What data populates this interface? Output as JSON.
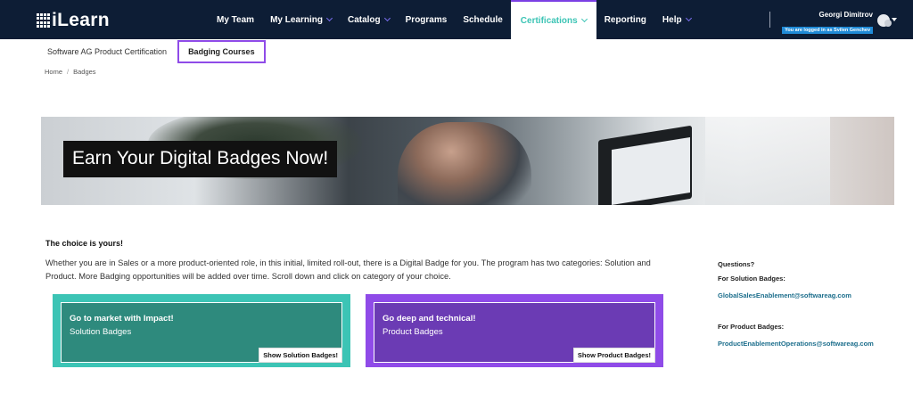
{
  "app": {
    "logo_text": "iLearn"
  },
  "nav": {
    "items": [
      {
        "label": "My Team",
        "has_chevron": false
      },
      {
        "label": "My Learning",
        "has_chevron": true
      },
      {
        "label": "Catalog",
        "has_chevron": true
      },
      {
        "label": "Programs",
        "has_chevron": false
      },
      {
        "label": "Schedule",
        "has_chevron": false
      },
      {
        "label": "Certifications",
        "has_chevron": true,
        "active": true
      },
      {
        "label": "Reporting",
        "has_chevron": false
      },
      {
        "label": "Help",
        "has_chevron": true
      }
    ]
  },
  "user": {
    "name": "Georgi Dimitrov",
    "impersonation": "You are logged in as Svilen Genchev"
  },
  "subtabs": [
    {
      "label": "Software AG Product Certification",
      "selected": false
    },
    {
      "label": "Badging Courses",
      "selected": true
    }
  ],
  "breadcrumb": {
    "home": "Home",
    "separator": "/",
    "current": "Badges"
  },
  "hero": {
    "title": "Earn Your Digital Badges Now!"
  },
  "intro": {
    "heading": "The choice is yours!",
    "text": "Whether you are in Sales or a more product-oriented role, in this initial, limited roll-out, there is a Digital Badge for you. The program has two categories: Solution and Product. More Badging opportunities will be added over time. Scroll down and click on category of your choice."
  },
  "cards": {
    "solution": {
      "title": "Go to market with Impact!",
      "subtitle": "Solution Badges",
      "button": "Show Solution Badges!",
      "accent": "#3cc4b5",
      "inner": "#2e8a7d"
    },
    "product": {
      "title": "Go deep and technical!",
      "subtitle": "Product Badges",
      "button": "Show Product Badges!",
      "accent": "#8f4be8",
      "inner": "#6b3bb4"
    }
  },
  "sidebar": {
    "questions": "Questions?",
    "solution_label": "For Solution Badges:",
    "solution_email": "GlobalSalesEnablement@softwareag.com",
    "product_label": "For Product Badges:",
    "product_email": "ProductEnablementOperations@softwareag.com"
  },
  "colors": {
    "topbar": "#0d1d35",
    "accent_teal": "#3cc4b5",
    "accent_purple": "#8f4be8",
    "link": "#1c6e8c"
  }
}
